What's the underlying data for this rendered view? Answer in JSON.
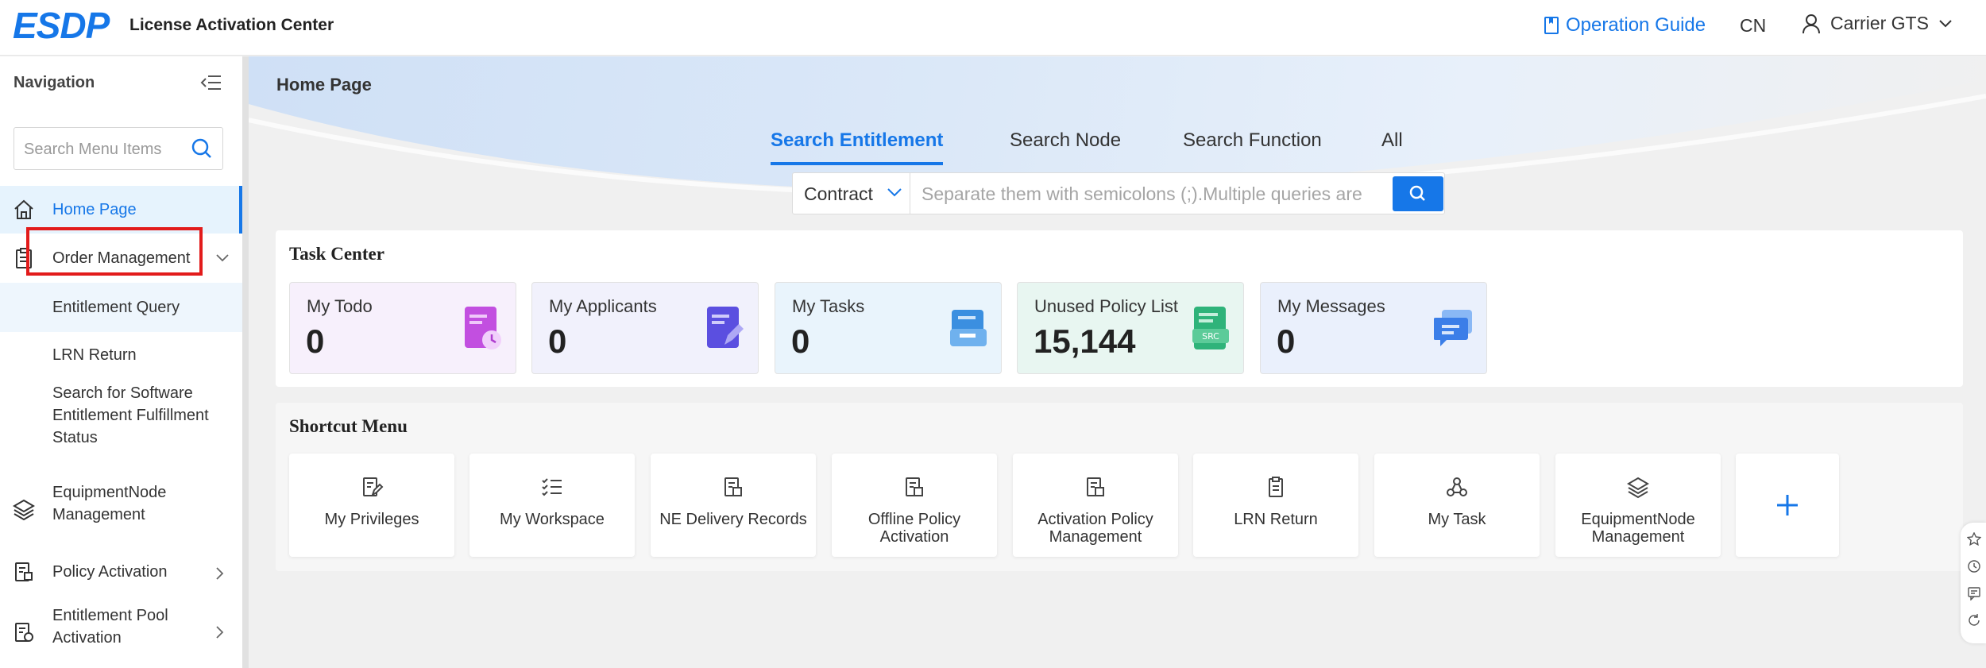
{
  "header": {
    "logo": "ESDP",
    "app_title": "License Activation Center",
    "operation_guide": "Operation Guide",
    "language": "CN",
    "user_name": "Carrier GTS"
  },
  "sidebar": {
    "title": "Navigation",
    "search_placeholder": "Search Menu Items",
    "items": {
      "home": "Home Page",
      "order_management": "Order Management",
      "entitlement_query": "Entitlement Query",
      "lrn_return": "LRN Return",
      "search_software_1": "Search for Software",
      "search_software_2": "Entitlement Fulfillment",
      "search_software_3": "Status",
      "equipment_1": "EquipmentNode",
      "equipment_2": "Management",
      "policy_activation": "Policy Activation",
      "pool_1": "Entitlement Pool",
      "pool_2": "Activation"
    }
  },
  "main": {
    "page_title": "Home Page",
    "tabs": [
      "Search Entitlement",
      "Search Node",
      "Search Function",
      "All"
    ],
    "search": {
      "select_value": "Contract",
      "placeholder": "Separate them with semicolons (;).Multiple queries are"
    },
    "task_center": {
      "title": "Task Center",
      "cards": [
        {
          "label": "My Todo",
          "count": "0"
        },
        {
          "label": "My Applicants",
          "count": "0"
        },
        {
          "label": "My Tasks",
          "count": "0"
        },
        {
          "label": "Unused Policy List",
          "count": "15,144"
        },
        {
          "label": "My Messages",
          "count": "0"
        }
      ]
    },
    "shortcut_menu": {
      "title": "Shortcut Menu",
      "items": [
        {
          "l1": "My Privileges",
          "l2": ""
        },
        {
          "l1": "My Workspace",
          "l2": ""
        },
        {
          "l1": "NE Delivery Records",
          "l2": ""
        },
        {
          "l1": "Offline Policy Activation",
          "l2": ""
        },
        {
          "l1": "Activation Policy",
          "l2": "Management"
        },
        {
          "l1": "LRN Return",
          "l2": ""
        },
        {
          "l1": "My Task",
          "l2": ""
        },
        {
          "l1": "EquipmentNode",
          "l2": "Management"
        }
      ]
    }
  },
  "colors": {
    "accent": "#1677e8",
    "highlight": "#e21b1b"
  }
}
